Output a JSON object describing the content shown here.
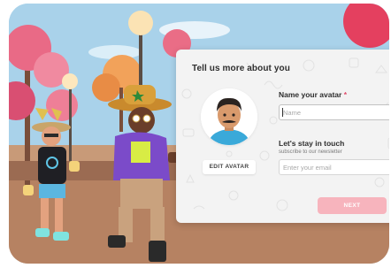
{
  "form": {
    "title": "Tell us more about you",
    "edit_avatar_label": "EDIT AVATAR",
    "name_label": "Name your avatar",
    "name_required_mark": "*",
    "name_placeholder": "Name",
    "contact_label": "Let's stay in touch",
    "contact_sublabel": "subscribe to our newsletter",
    "email_placeholder": "Enter your email",
    "next_label": "NEXT"
  },
  "colors": {
    "next_button": "#f7b4bd",
    "required_mark": "#e04b6a",
    "panel_background": "#f3f3f3"
  },
  "icons": {
    "decorative_pattern": "doodle-pattern-icons",
    "avatar_preview": "avatar-portrait"
  }
}
